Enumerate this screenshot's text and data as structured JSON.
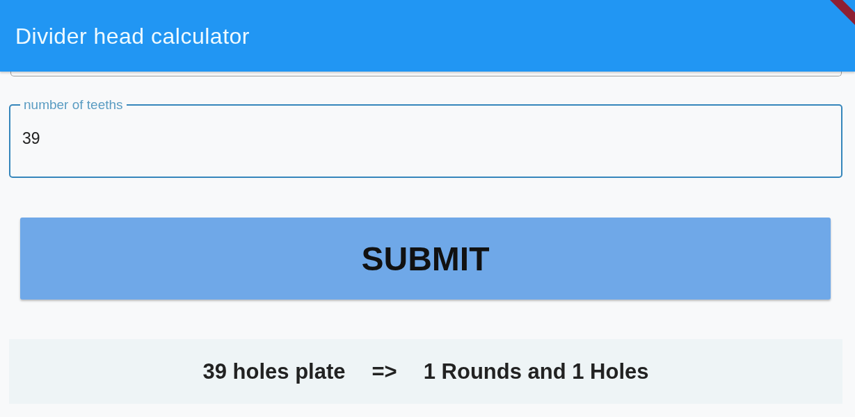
{
  "app_bar": {
    "title": "Divider head calculator",
    "debug_banner": true
  },
  "fields": [
    {
      "kind": "covered",
      "focused": false
    },
    {
      "kind": "outlined",
      "label": "number of teeths",
      "value": "39",
      "focused": true
    }
  ],
  "submit_button": {
    "label": "SUBMIT"
  },
  "result": {
    "plate": "39 holes plate",
    "arrow": "=>",
    "answer": "1 Rounds and 1 Holes"
  }
}
